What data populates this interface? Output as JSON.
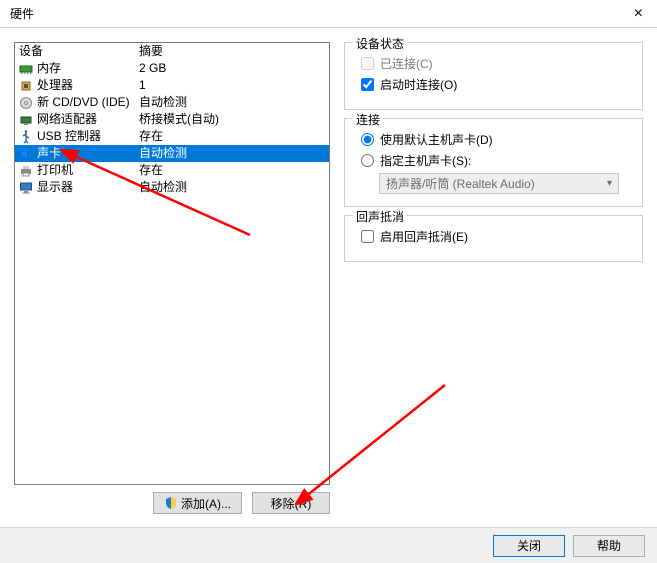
{
  "window": {
    "title": "硬件"
  },
  "left": {
    "header": {
      "device": "设备",
      "summary": "摘要"
    },
    "rows": [
      {
        "icon": "memory-icon",
        "device": "内存",
        "summary": "2 GB"
      },
      {
        "icon": "cpu-icon",
        "device": "处理器",
        "summary": "1"
      },
      {
        "icon": "cd-icon",
        "device": "新 CD/DVD (IDE)",
        "summary": "自动检测"
      },
      {
        "icon": "network-icon",
        "device": "网络适配器",
        "summary": "桥接模式(自动)"
      },
      {
        "icon": "usb-icon",
        "device": "USB 控制器",
        "summary": "存在"
      },
      {
        "icon": "sound-icon",
        "device": "声卡",
        "summary": "自动检测"
      },
      {
        "icon": "printer-icon",
        "device": "打印机",
        "summary": "存在"
      },
      {
        "icon": "display-icon",
        "device": "显示器",
        "summary": "自动检测"
      }
    ],
    "selected_index": 5,
    "buttons": {
      "add": "添加(A)...",
      "remove": "移除(R)"
    }
  },
  "right": {
    "status": {
      "legend": "设备状态",
      "connected": {
        "label": "已连接(C)",
        "checked": false,
        "enabled": false
      },
      "connect_at_power_on": {
        "label": "启动时连接(O)",
        "checked": true
      }
    },
    "connection": {
      "legend": "连接",
      "use_default": {
        "label": "使用默认主机声卡(D)",
        "selected": true
      },
      "specify": {
        "label": "指定主机声卡(S):",
        "selected": false
      },
      "dropdown_value": "扬声器/听筒 (Realtek Audio)"
    },
    "echo": {
      "legend": "回声抵消",
      "enable": {
        "label": "启用回声抵消(E)",
        "checked": false
      }
    }
  },
  "footer": {
    "close": "关闭",
    "help": "帮助"
  }
}
